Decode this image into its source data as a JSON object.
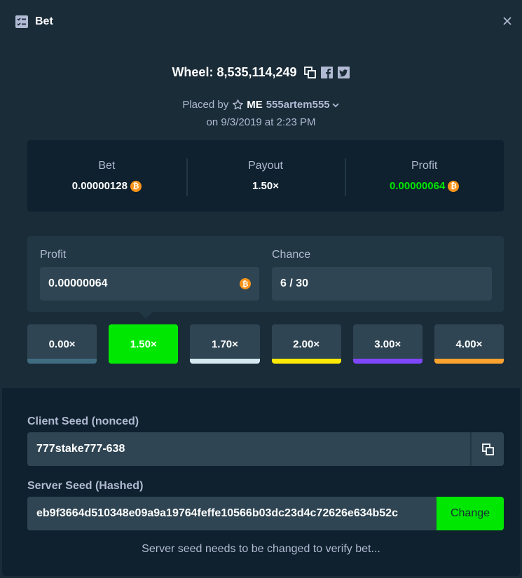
{
  "header": {
    "title": "Bet",
    "title_icon": "checklist-icon",
    "close_icon": "close-icon"
  },
  "bet": {
    "title": "Wheel: 8,535,114,249",
    "icons": [
      "copy-icon",
      "facebook-icon",
      "twitter-icon"
    ],
    "placed_by_prefix": "Placed by",
    "badge": "ME",
    "username": "555artem555",
    "date": "on 9/3/2019 at 2:23 PM"
  },
  "summary": {
    "bet_label": "Bet",
    "bet_value": "0.00000128",
    "payout_label": "Payout",
    "payout_value": "1.50×",
    "profit_label": "Profit",
    "profit_value": "0.00000064"
  },
  "calc": {
    "profit_label": "Profit",
    "profit_value": "0.00000064",
    "chance_label": "Chance",
    "chance_value": "6 / 30"
  },
  "multipliers": [
    {
      "label": "0.00×",
      "color": "#406c82",
      "active": false
    },
    {
      "label": "1.50×",
      "color": "#00e701",
      "active": true
    },
    {
      "label": "1.70×",
      "color": "#d5e8f2",
      "active": false
    },
    {
      "label": "2.00×",
      "color": "#fde905",
      "active": false
    },
    {
      "label": "3.00×",
      "color": "#7f47fd",
      "active": false
    },
    {
      "label": "4.00×",
      "color": "#fca32f",
      "active": false
    }
  ],
  "seeds": {
    "client_label": "Client Seed (nonced)",
    "client_value": "777stake777-638",
    "server_label": "Server Seed (Hashed)",
    "server_value": "eb9f3664d510348e09a9a19764feffe10566b03dc23d4c72626e634b52c",
    "change_label": "Change",
    "note": "Server seed needs to be changed to verify bet..."
  },
  "colors": {
    "accent_green": "#00e701",
    "bitcoin": "#f7931a"
  }
}
